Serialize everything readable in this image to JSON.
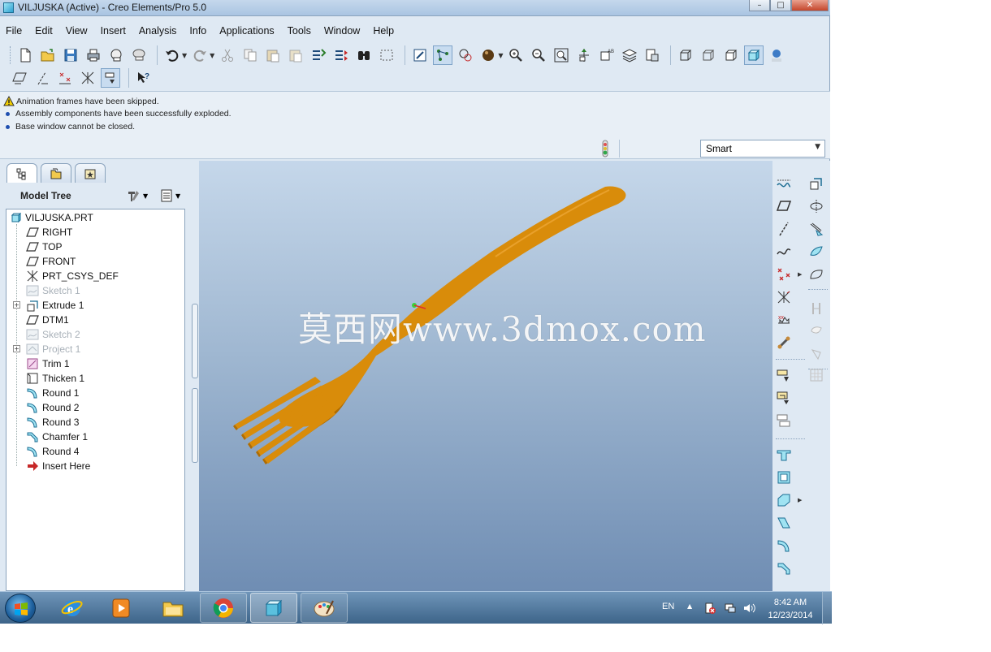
{
  "window": {
    "title": "VILJUSKA (Active) - Creo Elements/Pro 5.0",
    "controls": {
      "minimize": "–",
      "maximize": "□",
      "close": "✕"
    }
  },
  "menu": {
    "items": [
      "File",
      "Edit",
      "View",
      "Insert",
      "Analysis",
      "Info",
      "Applications",
      "Tools",
      "Window",
      "Help"
    ]
  },
  "toolbar_icons": {
    "row1": [
      "new-file",
      "open-folder",
      "save",
      "print",
      "send-mail",
      "mail-link",
      "undo",
      "redo",
      "cut",
      "copy",
      "paste",
      "paste-special",
      "regenerate",
      "regenerate-manager",
      "find",
      "select-box",
      "repaint",
      "spin-center",
      "orient-mode",
      "appearance",
      "zoom-in",
      "zoom-out",
      "refit",
      "reorient",
      "saved-views",
      "layers",
      "view-manager",
      "wireframe",
      "hidden-line",
      "no-hidden",
      "shading",
      "enhanced-realism"
    ],
    "row2": [
      "datum-planes",
      "datum-axes",
      "datum-points",
      "datum-csys",
      "annotations",
      "whats-this"
    ]
  },
  "messages": [
    {
      "type": "warning",
      "text": "Animation frames have been skipped."
    },
    {
      "type": "info",
      "text": "Assembly components have been successfully exploded."
    },
    {
      "type": "info",
      "text": "Base window cannot be closed."
    }
  ],
  "filter": {
    "selected": "Smart"
  },
  "navigator": {
    "header": "Model Tree",
    "tabs": [
      "model-tree",
      "folder-browser",
      "favorites"
    ]
  },
  "model_tree": {
    "root": "VILJUSKA.PRT",
    "items": [
      {
        "label": "RIGHT",
        "icon": "datum-plane",
        "dim": false,
        "expandable": false
      },
      {
        "label": "TOP",
        "icon": "datum-plane",
        "dim": false,
        "expandable": false
      },
      {
        "label": "FRONT",
        "icon": "datum-plane",
        "dim": false,
        "expandable": false
      },
      {
        "label": "PRT_CSYS_DEF",
        "icon": "csys",
        "dim": false,
        "expandable": false
      },
      {
        "label": "Sketch 1",
        "icon": "sketch",
        "dim": true,
        "expandable": false
      },
      {
        "label": "Extrude 1",
        "icon": "extrude",
        "dim": false,
        "expandable": true
      },
      {
        "label": "DTM1",
        "icon": "datum-plane",
        "dim": false,
        "expandable": false
      },
      {
        "label": "Sketch 2",
        "icon": "sketch",
        "dim": true,
        "expandable": false
      },
      {
        "label": "Project 1",
        "icon": "project",
        "dim": true,
        "expandable": true
      },
      {
        "label": "Trim 1",
        "icon": "trim",
        "dim": false,
        "expandable": false
      },
      {
        "label": "Thicken 1",
        "icon": "thicken",
        "dim": false,
        "expandable": false
      },
      {
        "label": "Round 1",
        "icon": "round",
        "dim": false,
        "expandable": false
      },
      {
        "label": "Round 2",
        "icon": "round",
        "dim": false,
        "expandable": false
      },
      {
        "label": "Round 3",
        "icon": "round",
        "dim": false,
        "expandable": false
      },
      {
        "label": "Chamfer 1",
        "icon": "chamfer",
        "dim": false,
        "expandable": false
      },
      {
        "label": "Round 4",
        "icon": "round",
        "dim": false,
        "expandable": false
      },
      {
        "label": "Insert Here",
        "icon": "insert-arrow",
        "dim": false,
        "expandable": false
      }
    ]
  },
  "graphics": {
    "watermark": "莫西网www.3dmox.com",
    "model_color": "#d98c0a"
  },
  "right_toolbar_icons": [
    "sketch-tool",
    "plane-tool",
    "axis-tool",
    "curve-tool",
    "point-tool",
    "csys-tool",
    "analysis-feature",
    "datum-tool",
    "extrude-tool",
    "revolve-tool",
    "variable-sweep",
    "blend-tool",
    "boundary-blend",
    "mirror-tool",
    "merge-tool",
    "trim-tool",
    "pattern-tool",
    "hole-tool",
    "shell-tool",
    "rib-tool",
    "draft-tool",
    "round-tool",
    "chamfer-tool",
    "style-tool",
    "freestyle-tool",
    "copy-paste-tool"
  ],
  "taskbar": {
    "apps": [
      "windows-start",
      "internet-explorer",
      "media-player",
      "file-explorer",
      "chrome",
      "creo",
      "paint"
    ],
    "language": "EN",
    "time": "8:42 AM",
    "date": "12/23/2014"
  }
}
